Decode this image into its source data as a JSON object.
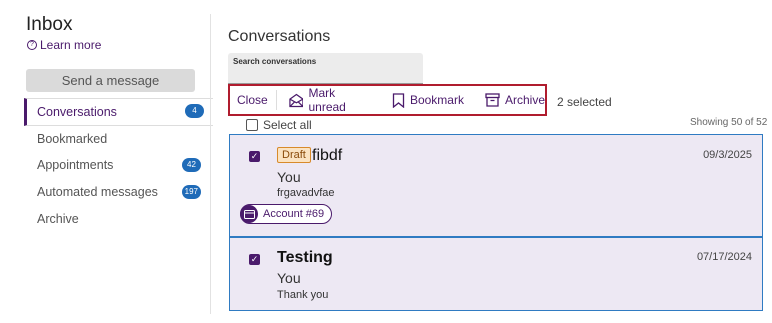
{
  "sidebar": {
    "title": "Inbox",
    "learn_more": "Learn more",
    "send_button": "Send a message",
    "items": [
      {
        "label": "Conversations",
        "badge": "4"
      },
      {
        "label": "Bookmarked"
      },
      {
        "label": "Appointments",
        "badge": "42"
      },
      {
        "label": "Automated messages",
        "badge": "197"
      },
      {
        "label": "Archive"
      }
    ]
  },
  "main": {
    "title": "Conversations",
    "search_label": "Search conversations",
    "toolbar": {
      "close": "Close",
      "mark_unread": "Mark unread",
      "bookmark": "Bookmark",
      "archive": "Archive"
    },
    "selected_count": "2 selected",
    "select_all": "Select all",
    "showing": "Showing 50 of 52",
    "conversations": [
      {
        "draft": "Draft",
        "subject": "fibdf",
        "sender": "You",
        "preview": "frgavadvfae",
        "date": "09/3/2025",
        "tag": "Account #69",
        "checked": true
      },
      {
        "subject": "Testing",
        "sender": "You",
        "preview": "Thank you",
        "date": "07/17/2024",
        "checked": true
      }
    ]
  },
  "colors": {
    "accent": "#4a1a6b",
    "badge": "#1f6bb8",
    "highlight_border": "#b01c2e",
    "card_bg": "#ede8f3"
  }
}
